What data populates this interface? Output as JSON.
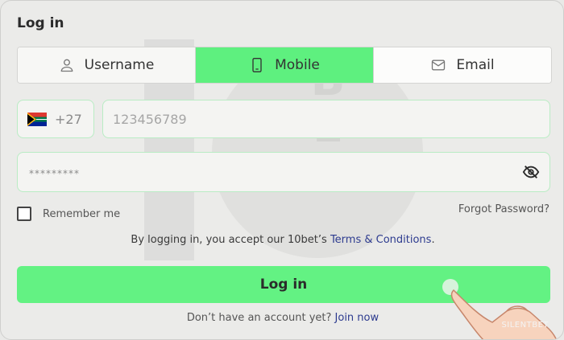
{
  "form": {
    "title": "Log in",
    "tabs": [
      {
        "label": "Username",
        "icon": "user-icon",
        "active": false
      },
      {
        "label": "Mobile",
        "icon": "mobile-icon",
        "active": true
      },
      {
        "label": "Email",
        "icon": "email-icon",
        "active": false
      }
    ],
    "country_code": "+27",
    "country_flag": "south-africa-flag-icon",
    "phone_placeholder": "123456789",
    "password_placeholder": "*********",
    "password_toggle_icon": "eye-slash-icon",
    "remember_label": "Remember me",
    "forgot_label": "Forgot Password?",
    "terms_text": "By logging in, you accept our 10bet’s",
    "terms_link": "Terms & Conditions",
    "terms_end": ".",
    "login_button": "Log in",
    "signup_text": "Don’t have an account yet?",
    "signup_link": "Join now"
  },
  "watermark": {
    "text": "BET",
    "credit": "SILENTBET"
  },
  "colors": {
    "accent_green": "#5ef07f",
    "link_blue": "#2d3b8f",
    "background": "#ebebe9"
  }
}
